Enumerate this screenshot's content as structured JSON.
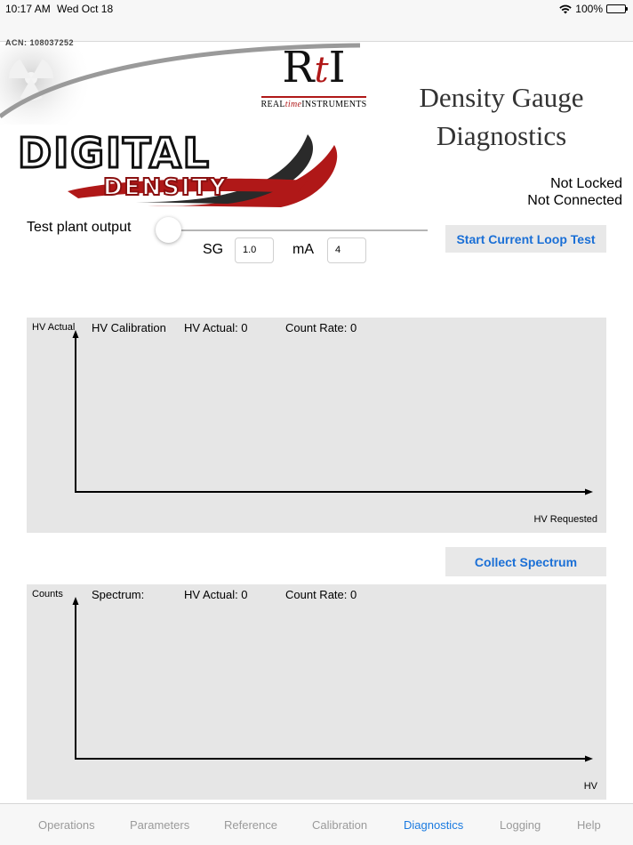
{
  "status_bar": {
    "time": "10:17 AM",
    "date": "Wed Oct 18",
    "battery": "100%"
  },
  "branding": {
    "acn": "ACN: 108037252",
    "rti_mark": "RtI",
    "rti_name_pre": "REAL",
    "rti_name_mid": "time",
    "rti_name_post": "INSTRUMENTS",
    "digital": "DIGITAL",
    "density": "DENSITY"
  },
  "page": {
    "title_line1": "Density Gauge",
    "title_line2": "Diagnostics",
    "lock_status": "Not Locked",
    "connection_status": "Not Connected"
  },
  "test_output": {
    "label": "Test plant output",
    "slider_value": 0,
    "sg_label": "SG",
    "sg_value": "1.0",
    "ma_label": "mA",
    "ma_value": "4",
    "loop_button": "Start Current Loop Test"
  },
  "hv_chart": {
    "y_title": "HV Actual",
    "title": "HV Calibration",
    "hv_actual": "HV Actual: 0",
    "count_rate": "Count Rate: 0",
    "x_title": "HV Requested"
  },
  "spectrum": {
    "button": "Collect Spectrum",
    "y_title": "Counts",
    "title": "Spectrum:",
    "hv_actual": "HV Actual: 0",
    "count_rate": "Count Rate: 0",
    "x_title": "HV"
  },
  "tabs": [
    {
      "label": "Operations",
      "active": false
    },
    {
      "label": "Parameters",
      "active": false
    },
    {
      "label": "Reference",
      "active": false
    },
    {
      "label": "Calibration",
      "active": false
    },
    {
      "label": "Diagnostics",
      "active": true
    },
    {
      "label": "Logging",
      "active": false
    },
    {
      "label": "Help",
      "active": false
    }
  ],
  "colors": {
    "accent": "#1a7ae0",
    "brand_red": "#b01818",
    "panel": "#e6e6e6"
  }
}
